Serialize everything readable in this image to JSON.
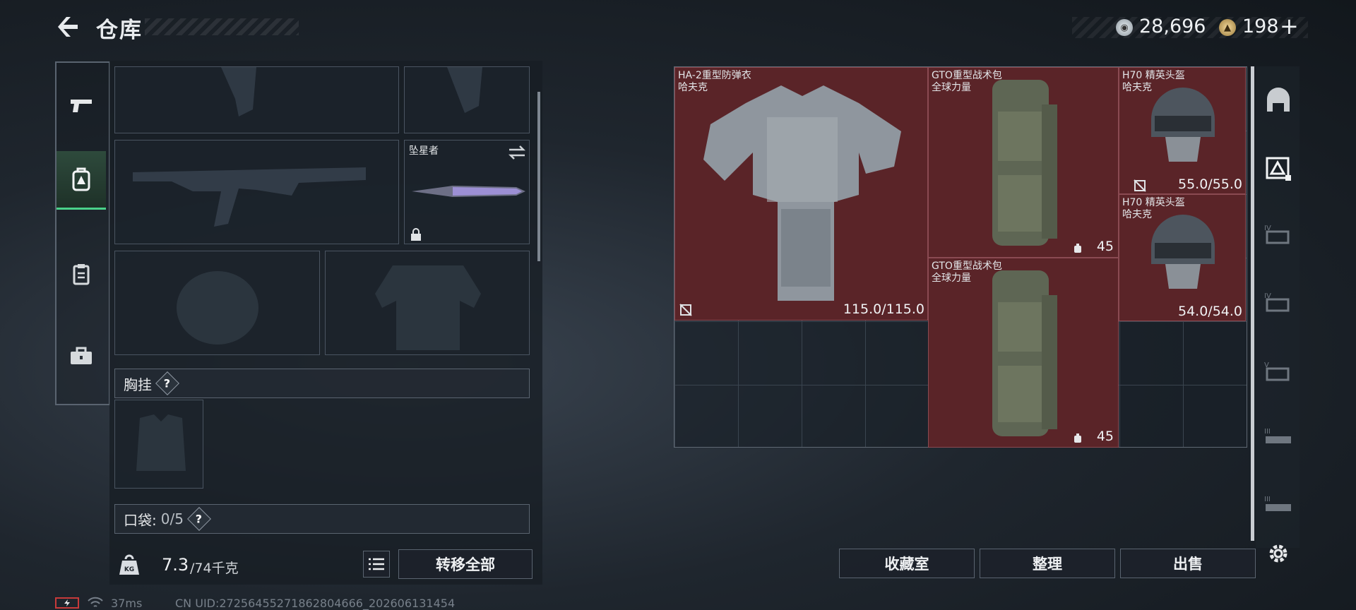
{
  "header": {
    "title": "仓库"
  },
  "currency": {
    "silver": "28,696",
    "gold": "198"
  },
  "left_panel": {
    "weapon_skin_label": "坠星者",
    "chest_rig_label": "胸挂",
    "pocket_label": "口袋:",
    "pocket_count": "0/5",
    "help_glyph": "?",
    "weight_value": "7.3",
    "weight_capacity": "/74千克",
    "transfer_all_button": "转移全部"
  },
  "stash": {
    "items": [
      {
        "name": "HA-2重型防弹衣",
        "brand": "哈夫克",
        "durability": "115.0/115.0"
      },
      {
        "name": "GTO重型战术包",
        "brand": "全球力量",
        "count": "45"
      },
      {
        "name": "H70 精英头盔",
        "brand": "哈夫克",
        "durability": "55.0/55.0"
      },
      {
        "name": "H70 精英头盔",
        "brand": "哈夫克",
        "durability": "54.0/54.0"
      },
      {
        "name": "GTO重型战术包",
        "brand": "全球力量",
        "count": "45"
      }
    ],
    "buttons": {
      "collection": "收藏室",
      "sort": "整理",
      "sell": "出售"
    }
  },
  "status_bar": {
    "ping": "37ms",
    "uid": "CN UID:27256455271862804666_202606131454"
  },
  "icons": {
    "back": "back-arrow-icon",
    "settings": "gear-icon"
  },
  "colors": {
    "item_bg": "#5a2428",
    "active_tab": "#4ad28a",
    "accent_text": "#e8ebee"
  }
}
